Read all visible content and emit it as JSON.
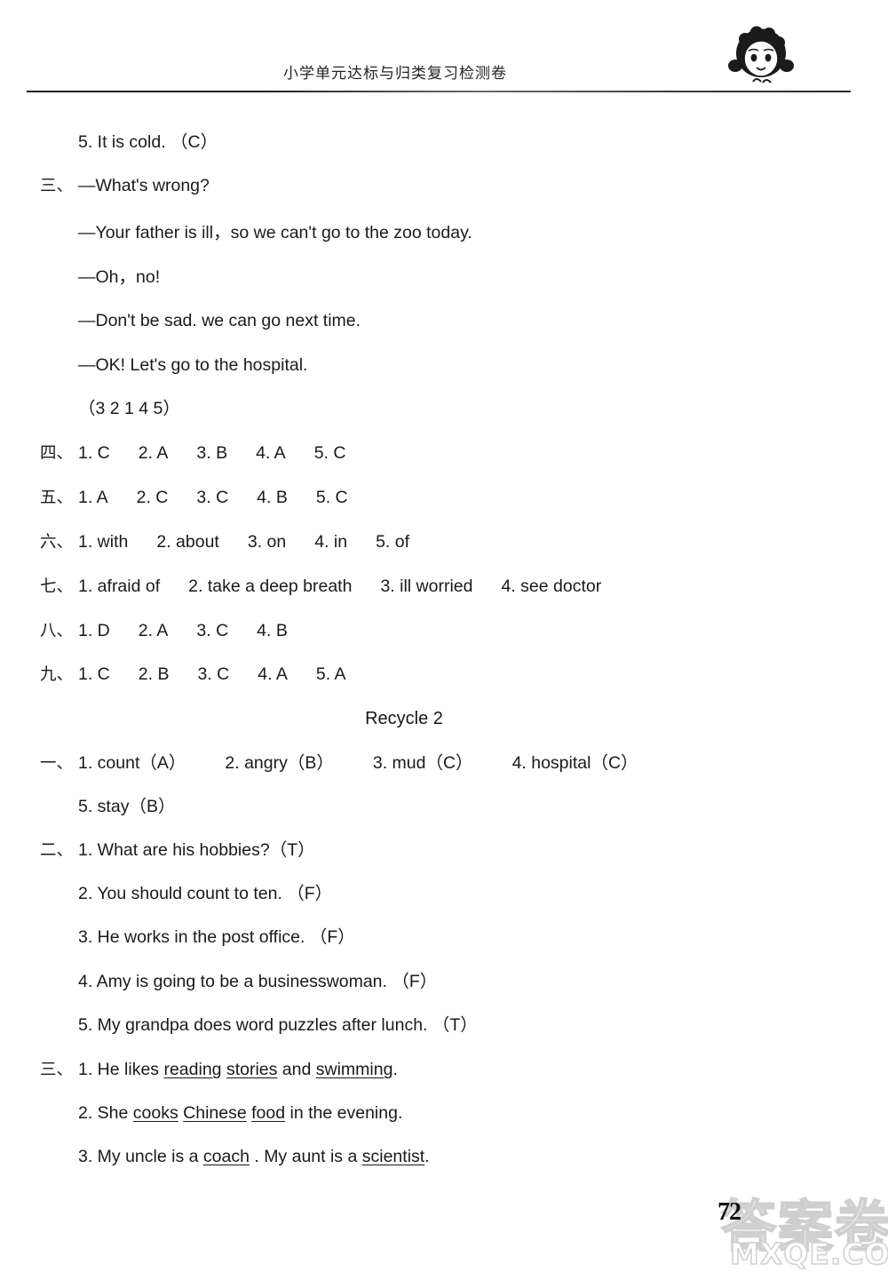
{
  "header": {
    "title": "小学单元达标与归类复习检测卷",
    "mascot_icon": "girl-mascot-icon"
  },
  "answers_top": {
    "item5": "5.  It is cold.  （C）",
    "section3": {
      "marker": "三、",
      "dialogue": [
        "—What's wrong?",
        "—Your father is ill，so we can't go to the zoo today.",
        "—Oh，no!",
        "—Don't be sad. we can go next time.",
        "—OK! Let's go to the hospital."
      ],
      "sequence": "（3     2     1     4     5）"
    },
    "section4": {
      "marker": "四、",
      "items": [
        "1. C",
        "2. A",
        "3. B",
        "4. A",
        "5. C"
      ]
    },
    "section5": {
      "marker": "五、",
      "items": [
        "1. A",
        "2. C",
        "3. C",
        "4. B",
        "5. C"
      ]
    },
    "section6": {
      "marker": "六、",
      "items": [
        "1. with",
        "2. about",
        "3. on",
        "4. in",
        "5. of"
      ]
    },
    "section7": {
      "marker": "七、",
      "items": [
        "1. afraid  of",
        "2. take  a  deep  breath",
        "3. ill  worried",
        "4. see  doctor"
      ]
    },
    "section8": {
      "marker": "八、",
      "items": [
        "1. D",
        "2. A",
        "3. C",
        "4. B"
      ]
    },
    "section9": {
      "marker": "九、",
      "items": [
        "1. C",
        "2. B",
        "3. C",
        "4. A",
        "5. A"
      ]
    }
  },
  "recycle": {
    "heading": "Recycle 2",
    "section1": {
      "marker": "一、",
      "row1": [
        "1. count（A）",
        "2. angry（B）",
        "3. mud（C）",
        "4. hospital（C）"
      ],
      "row2": "5. stay（B）"
    },
    "section2": {
      "marker": "二、",
      "items": [
        "1. What are his hobbies?（T）",
        "2. You should count to ten.  （F）",
        "3. He works in the post office.  （F）",
        "4. Amy is going to be a businesswoman.  （F）",
        "5. My grandpa does word puzzles after lunch.  （T）"
      ]
    },
    "section3": {
      "marker": "三、",
      "item1": {
        "prefix": "1. He likes ",
        "u1": "reading",
        "mid1": " ",
        "u2": "stories",
        "mid2": " and ",
        "u3": "swimming",
        "suffix": "."
      },
      "item2": {
        "prefix": "2. She ",
        "u1": "cooks",
        "mid1": " ",
        "u2": "Chinese",
        "mid2": " ",
        "u3": "food",
        "suffix": " in the evening."
      },
      "item3": {
        "prefix": "3. My uncle is a ",
        "u1": "coach",
        "mid1": " .  My aunt is a ",
        "u2": "scientist",
        "suffix": "."
      }
    }
  },
  "footer": {
    "page_number": "72",
    "watermark_cn": "答案卷",
    "watermark_url": "MXQE.COM"
  }
}
